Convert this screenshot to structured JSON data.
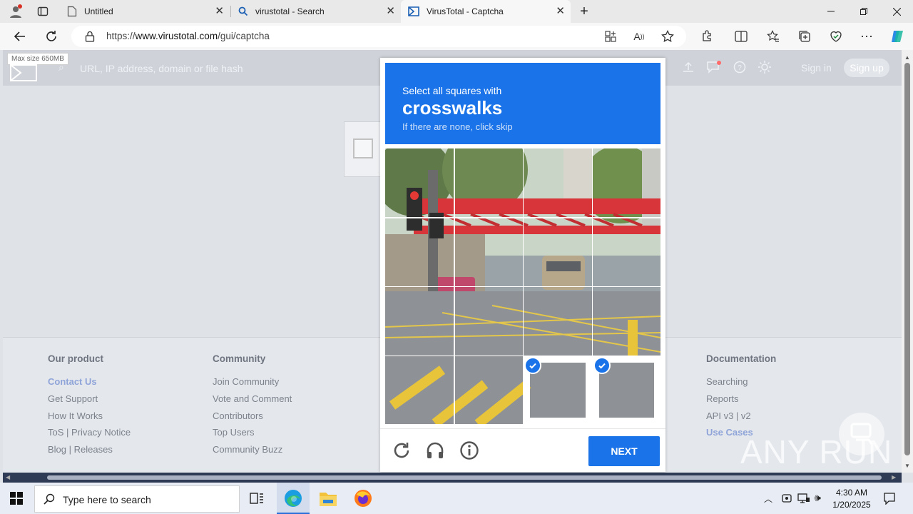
{
  "browser": {
    "tabs": [
      {
        "title": "Untitled",
        "icon": "page-icon"
      },
      {
        "title": "virustotal - Search",
        "icon": "search-icon"
      },
      {
        "title": "VirusTotal - Captcha",
        "icon": "virustotal-icon"
      }
    ],
    "url_prefix": "https://",
    "url_host": "www.virustotal.com",
    "url_path": "/gui/captcha"
  },
  "virustotal": {
    "max_size": "Max size 650MB",
    "search_placeholder": "URL, IP address, domain or file hash",
    "sign_in": "Sign in",
    "sign_up": "Sign up",
    "footer": {
      "columns": [
        {
          "heading": "Our product",
          "links": [
            "Contact Us",
            "Get Support",
            "How It Works",
            "ToS | Privacy Notice",
            "Blog | Releases"
          ]
        },
        {
          "heading": "Community",
          "links": [
            "Join Community",
            "Vote and Comment",
            "Contributors",
            "Top Users",
            "Community Buzz"
          ]
        },
        {
          "heading": "Documentation",
          "links": [
            "Searching",
            "Reports",
            "API v3 | v2",
            "Use Cases"
          ]
        }
      ]
    }
  },
  "captcha": {
    "instruction": "Select all squares with",
    "target": "crosswalks",
    "hint": "If there are none, click skip",
    "selected_tiles": [
      14,
      15
    ],
    "next_label": "NEXT"
  },
  "taskbar": {
    "search_placeholder": "Type here to search",
    "time": "4:30 AM",
    "date": "1/20/2025"
  },
  "watermark": "ANY RUN",
  "colors": {
    "accent": "#1a73e8",
    "vt_blue_link": "#3a6fe0"
  }
}
